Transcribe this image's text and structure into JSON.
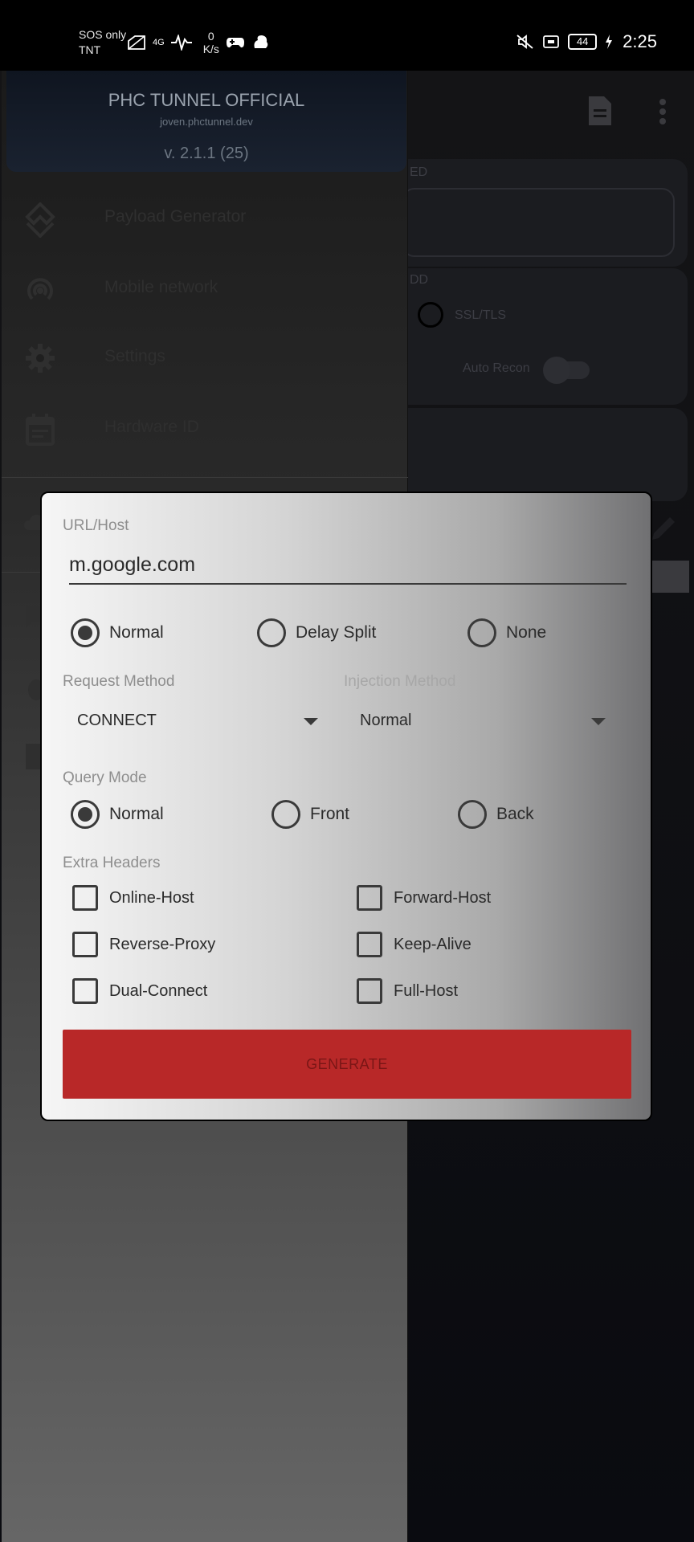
{
  "status_bar": {
    "carrier_line1": "SOS only",
    "carrier_line2": "TNT",
    "network_type": "4G",
    "speed_value": "0",
    "speed_unit": "K/s",
    "battery_level": "44",
    "time": "2:25"
  },
  "drawer": {
    "title": "PHC TUNNEL OFFICIAL",
    "subtitle": "joven.phctunnel.dev",
    "version": "v. 2.1.1 (25)",
    "items": [
      {
        "label": "Payload Generator",
        "icon": "payload-icon"
      },
      {
        "label": "Mobile network",
        "icon": "signal-icon"
      },
      {
        "label": "Settings",
        "icon": "gear-icon"
      },
      {
        "label": "Hardware ID",
        "icon": "calendar-icon"
      }
    ]
  },
  "background_app": {
    "card1_label": "ED",
    "card2_label": "DD",
    "radio_label": "SSL/TLS",
    "switch_label": "Auto Recon"
  },
  "dialog": {
    "url_label": "URL/Host",
    "url_value": "m.google.com",
    "split_options": [
      "Normal",
      "Delay Split",
      "None"
    ],
    "split_selected": "Normal",
    "request_method_label": "Request Method",
    "request_method_value": "CONNECT",
    "injection_method_label": "Injection Method",
    "injection_method_value": "Normal",
    "query_mode_label": "Query Mode",
    "query_options": [
      "Normal",
      "Front",
      "Back"
    ],
    "query_selected": "Normal",
    "extra_headers_label": "Extra Headers",
    "headers": [
      "Online-Host",
      "Forward-Host",
      "Reverse-Proxy",
      "Keep-Alive",
      "Dual-Connect",
      "Full-Host"
    ],
    "generate_label": "GENERATE",
    "colors": {
      "accent": "#b82828"
    }
  }
}
